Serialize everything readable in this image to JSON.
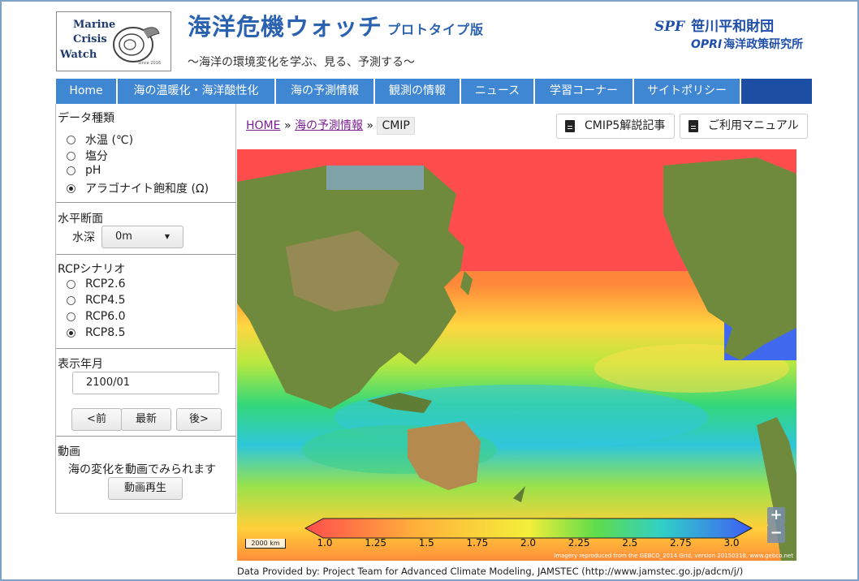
{
  "header": {
    "logo": {
      "line1": "Marine",
      "line2": "Crisis",
      "line3": "Watch",
      "since": "Since 2016"
    },
    "title": "海洋危機ウォッチ",
    "title_badge": "プロトタイプ版",
    "subtitle": "～海洋の環境変化を学ぶ、見る、予測する～",
    "sponsor1_logo": "SPF",
    "sponsor1": "笹川平和財団",
    "sponsor2_logo": "OPRI",
    "sponsor2": "海洋政策研究所"
  },
  "nav": {
    "items": [
      {
        "label": "Home"
      },
      {
        "label": "海の温暖化・海洋酸性化"
      },
      {
        "label": "海の予測情報"
      },
      {
        "label": "観測の情報"
      },
      {
        "label": "ニュース"
      },
      {
        "label": "学習コーナー"
      },
      {
        "label": "サイトポリシー"
      }
    ]
  },
  "sidebar": {
    "data_type": {
      "title": "データ種類",
      "options": [
        {
          "label": "水温 (℃)",
          "checked": false
        },
        {
          "label": "塩分",
          "checked": false
        },
        {
          "label": "pH",
          "checked": false
        },
        {
          "label": "アラゴナイト飽和度 (Ω)",
          "checked": true
        }
      ]
    },
    "horizontal": {
      "title": "水平断面",
      "depth_label": "水深",
      "depth_value": "0m"
    },
    "rcp": {
      "title": "RCPシナリオ",
      "options": [
        {
          "label": "RCP2.6",
          "checked": false
        },
        {
          "label": "RCP4.5",
          "checked": false
        },
        {
          "label": "RCP6.0",
          "checked": false
        },
        {
          "label": "RCP8.5",
          "checked": true
        }
      ]
    },
    "date": {
      "title": "表示年月",
      "value": "2100/01",
      "prev": "<前",
      "latest": "最新",
      "next": "後>"
    },
    "animation": {
      "title": "動画",
      "desc": "海の変化を動画でみられます",
      "play": "動画再生"
    }
  },
  "breadcrumb": {
    "home": "HOME",
    "sep": "»",
    "forecast": "海の予測情報",
    "current": "CMIP"
  },
  "doc_buttons": {
    "cmip5": "CMIP5解説記事",
    "manual": "ご利用マニュアル"
  },
  "map": {
    "scale": "2000 km",
    "credit": "Imagery reproduced from the GEBCO_2014 Grid, version 20150318, www.gebco.net",
    "zoom_in": "+",
    "zoom_out": "−",
    "colorbar_ticks": [
      "1.0",
      "1.25",
      "1.5",
      "1.75",
      "2.0",
      "2.25",
      "2.5",
      "2.75",
      "3.0"
    ]
  },
  "footer": "Data Provided by: Project Team for Advanced Climate Modeling, JAMSTEC (http://www.jamstec.go.jp/adcm/j/)",
  "colors": {
    "nav_bg": "#3f86d3",
    "nav_dark": "#1c4fa3",
    "title": "#2b62b0"
  }
}
